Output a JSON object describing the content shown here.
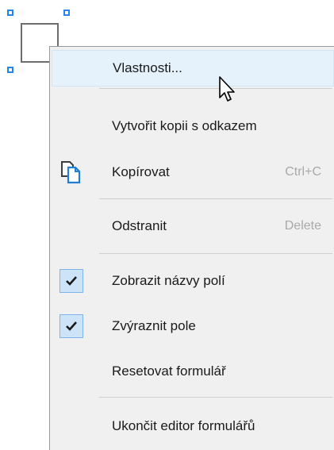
{
  "menu": {
    "items": [
      {
        "label": "Vlastnosti...",
        "shortcut": "",
        "icon": "",
        "checked": false,
        "hover": true
      },
      {
        "label": "Vytvořit kopii s odkazem",
        "shortcut": "",
        "icon": "",
        "checked": false,
        "hover": false
      },
      {
        "label": "Kopírovat",
        "shortcut": "Ctrl+C",
        "icon": "copy-icon",
        "checked": false,
        "hover": false
      },
      {
        "label": "Odstranit",
        "shortcut": "Delete",
        "icon": "",
        "checked": false,
        "hover": false
      },
      {
        "label": "Zobrazit názvy polí",
        "shortcut": "",
        "icon": "checkmark-icon",
        "checked": true,
        "hover": false
      },
      {
        "label": "Zvýraznit pole",
        "shortcut": "",
        "icon": "checkmark-icon",
        "checked": true,
        "hover": false
      },
      {
        "label": "Resetovat formulář",
        "shortcut": "",
        "icon": "",
        "checked": false,
        "hover": false
      },
      {
        "label": "Ukončit editor formulářů",
        "shortcut": "",
        "icon": "",
        "checked": false,
        "hover": false
      }
    ]
  },
  "colors": {
    "menu_background": "#f0f0f0",
    "hover_background": "#e5f1fb",
    "check_background": "#cde3f7",
    "handle_color": "#2a83e6",
    "shortcut_text": "#a9a9a9"
  }
}
